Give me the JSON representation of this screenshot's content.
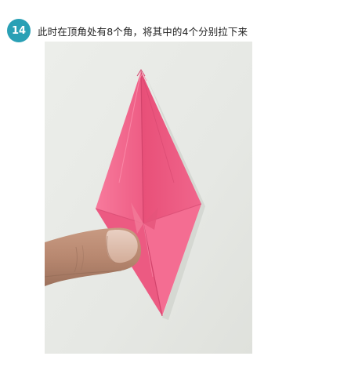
{
  "step": {
    "number": "14",
    "instruction": "此时在顶角处有8个角，将其中的4个分别拉下来"
  },
  "colors": {
    "badge": "#2aa0b5",
    "paper": "#f0648a",
    "background": "#e8e9e6"
  },
  "photo": {
    "icon": "origami-crane-base-photo"
  }
}
